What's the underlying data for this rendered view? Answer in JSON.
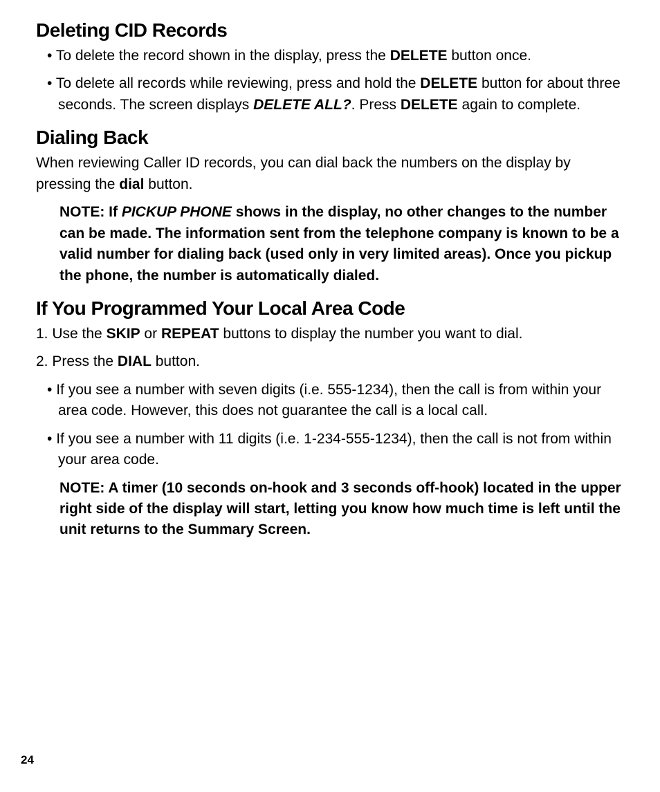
{
  "sections": [
    {
      "heading": "Deleting CID Records",
      "items": [
        {
          "type": "bullet",
          "runs": [
            {
              "t": "To delete the record shown in the display, press the "
            },
            {
              "t": "DELETE",
              "b": true
            },
            {
              "t": " button once."
            }
          ]
        },
        {
          "type": "bullet",
          "runs": [
            {
              "t": "To delete all records while reviewing, press and hold the "
            },
            {
              "t": "DELETE",
              "b": true
            },
            {
              "t": " button for about three seconds. The screen displays "
            },
            {
              "t": "DELETE ALL?",
              "b": true,
              "i": true
            },
            {
              "t": ".  Press "
            },
            {
              "t": "DELETE",
              "b": true
            },
            {
              "t": " again to complete."
            }
          ]
        }
      ]
    },
    {
      "heading": "Dialing Back",
      "items": [
        {
          "type": "para",
          "runs": [
            {
              "t": "When reviewing Caller ID records, you can dial back the numbers on the display by pressing the "
            },
            {
              "t": "dial",
              "b": true
            },
            {
              "t": " button."
            }
          ]
        },
        {
          "type": "note",
          "runs": [
            {
              "t": "NOTE: If ",
              "b": true
            },
            {
              "t": "PICKUP PHONE",
              "b": true,
              "i": true
            },
            {
              "t": " shows in the display, no other changes to the number can be made. The information sent from the telephone company is known to be a valid number for dialing back (used only in very limited areas). Once you pickup the phone, the number is automatically dialed.",
              "b": true
            }
          ]
        }
      ]
    },
    {
      "heading": "If You Programmed Your Local Area Code",
      "items": [
        {
          "type": "num",
          "num": "1.",
          "runs": [
            {
              "t": "Use the "
            },
            {
              "t": "SKIP",
              "b": true
            },
            {
              "t": " or "
            },
            {
              "t": "REPEAT",
              "b": true
            },
            {
              "t": " buttons to display the number you want to dial."
            }
          ]
        },
        {
          "type": "num",
          "num": "2.",
          "runs": [
            {
              "t": "Press the "
            },
            {
              "t": "DIAL",
              "b": true
            },
            {
              "t": " button."
            }
          ]
        },
        {
          "type": "bullet",
          "runs": [
            {
              "t": "If you see a number with seven digits (i.e. 555-1234), then the call is from within your area code. However, this does not guarantee the call is a local call."
            }
          ]
        },
        {
          "type": "bullet",
          "runs": [
            {
              "t": "If you see a number with 11 digits (i.e. 1-234-555-1234), then the call is not from within your area code."
            }
          ]
        },
        {
          "type": "note",
          "runs": [
            {
              "t": "NOTE: A timer (10 seconds on-hook and 3 seconds off-hook) located in the upper right side of the display will start, letting you know how much time is left until the unit returns to the Summary Screen.",
              "b": true
            }
          ]
        }
      ]
    }
  ],
  "page_number": "24"
}
